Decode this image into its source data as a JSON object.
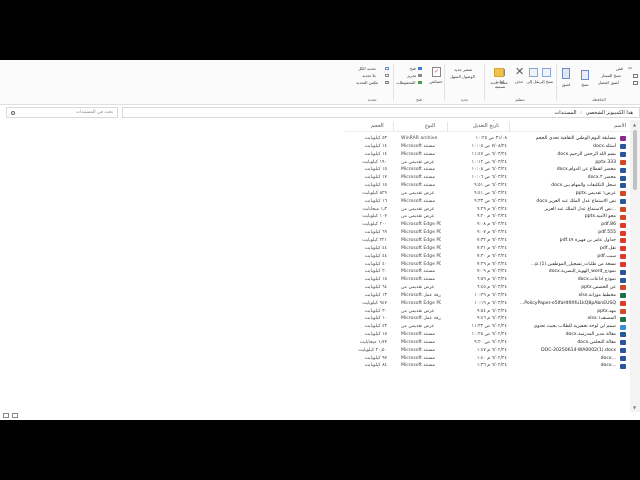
{
  "ribbon": {
    "clipboard": {
      "cut": "قص",
      "copy_path": "نسخ المسار",
      "paste_shortcut": "لصق اختصار",
      "copy": "نسخ",
      "paste": "لصق",
      "group_label": "الحافظة"
    },
    "organize": {
      "move_to": "نقل إلى",
      "copy_to": "نسخ إلى",
      "delete": "حذف",
      "rename": "إعادة تسمية",
      "group_label": "تنظيم"
    },
    "new": {
      "new_folder": "مجلد جديد",
      "new_item": "عنصر جديد",
      "easy_access": "الوصول السهل",
      "group_label": "جديد"
    },
    "open": {
      "properties": "خصائص",
      "open": "فتح",
      "edit": "تحرير",
      "history": "المحفوظات",
      "group_label": "فتح"
    },
    "select": {
      "select_all": "تحديد الكل",
      "select_none": "بلا تحديد",
      "invert_selection": "عكس التحديد",
      "group_label": "تحديد"
    }
  },
  "address": {
    "root": "هذا الكمبيوتر الشخصي",
    "current": "المستندات",
    "separator": "›"
  },
  "search": {
    "placeholder": "بحث في المستندات"
  },
  "columns": {
    "name": "الاسم",
    "date": "تاريخ التعديل",
    "type": "النوع",
    "size": "الحجم"
  },
  "files": [
    {
      "name": "مسابقة اليوم الوطني الثقافية تحدي الحجم",
      "date": "٣١/٠٨ ص ١٠:٢٥",
      "type": "WinRAR archive",
      "size": "٥٣ كيلوبايت",
      "icon": "rar"
    },
    {
      "name": "أسئلة.docx",
      "date": "٧/٠٨/٢٤ ص ١٠:٠٥",
      "type": "Microsoft مستند",
      "size": "١٤ كيلوبايت",
      "icon": "word"
    },
    {
      "name": "بسم الله الرحمن الرحيم.docx",
      "date": "٦/٠٣/٢٤ ص ١١:٤٧",
      "type": "Microsoft مستند",
      "size": "١٤ كيلوبايت",
      "icon": "word"
    },
    {
      "name": "333.pptx",
      "date": "٦/٠٣/٢٤ ص ١٠:١٢",
      "type": "عرض تقديمي من",
      "size": "١٩٠ كيلوبايت",
      "icon": "ppt"
    },
    {
      "name": "محضر انقطاع عن الدوام.docx",
      "date": "٦/٠٣/٢٤ ص ١٠:٠٨",
      "type": "Microsoft مستند",
      "size": "١٥ كيلوبايت",
      "icon": "word"
    },
    {
      "name": "محضر ٢.docx",
      "date": "٦/٠٣/٢٤ ص ١٠:٠٦",
      "type": "Microsoft مستند",
      "size": "١٧ كيلوبايت",
      "icon": "word"
    },
    {
      "name": "سجل التكليفات والمهام بين.docx",
      "date": "٦/٠٣/٢٤ ص ٩:٥١",
      "type": "Microsoft مستند",
      "size": "١٥ كيلوبايت",
      "icon": "word"
    },
    {
      "name": "عرض١ تقديمي.pptx",
      "date": "٦/٠٣/٢٤ ص ٩:٤١",
      "type": "عرض تقديمي من",
      "size": "٨٢٩ كيلوبايت",
      "icon": "ppt"
    },
    {
      "name": "نص الاستماع عدل الملك عبد العزيز.docx",
      "date": "٦/٠٣/٢٤ ص ٩:٣٣",
      "type": "Microsoft مستند",
      "size": "١٦ كيلوبايت",
      "icon": "word"
    },
    {
      "name": "...نص الاستماع عدل الملك عبد العزيز",
      "date": "٦/٠٣/٢٤ م ٩:٢٩",
      "type": "عرض تقديمي من",
      "size": "١٫٣ ميجابايت",
      "icon": "ppt"
    },
    {
      "name": "محو الأمية.pptx",
      "date": "٦/٠٣/٢٤ م ٩:٢٠",
      "type": "عرض تقديمي من",
      "size": "١٠٧ كيلوبايت",
      "icon": "ppt"
    },
    {
      "name": "86.pdf",
      "date": "٦/٠٣/٢٤ م ٩:٠٨",
      "type": "Microsoft Edge PD...",
      "size": "٢٠٠ كيلوبايت",
      "icon": "pdf"
    },
    {
      "name": "555.pdf",
      "date": "٦/٠٣/٢٤ م ٩:٠٧",
      "type": "Microsoft Edge PD...",
      "size": "٦٩ كيلوبايت",
      "icon": "pdf"
    },
    {
      "name": "جداول عامر بن فهيرة ٤٧.pdf",
      "date": "٦/٠٣/٢٤ م ٧:٣٢",
      "type": "Microsoft Edge PD...",
      "size": "٢٢١ كيلوبايت",
      "icon": "pdf"
    },
    {
      "name": "تقل.pdf",
      "date": "٦/٠٣/٢٤ م ٧:٣١",
      "type": "Microsoft Edge PD...",
      "size": "٤٤ كيلوبايت",
      "icon": "pdf"
    },
    {
      "name": "سبب.pdf",
      "date": "٦/٠٣/٢٤ م ٧:٣٠",
      "type": "Microsoft Edge PD...",
      "size": "٤٤ كيلوبايت",
      "icon": "pdf"
    },
    {
      "name": "نسخة من طلبات_تسجيل_الموظفين.(1).p...",
      "date": "٦/٠٣/٢٤ م ٧:٢٩",
      "type": "Microsoft Edge PD...",
      "size": "٤٠ كيلوبايت",
      "icon": "pdf"
    },
    {
      "name": "نموذج_word_الهوية_البصرية.docx",
      "date": "٦/٠٣/٢٤ م ٧:٠٩",
      "type": "Microsoft مستند",
      "size": "٢٠ كيلوبايت",
      "icon": "word"
    },
    {
      "name": "نموذج اذاعات.docx",
      "date": "٦/٠٣/٢٤ م ٦:٥٩",
      "type": "Microsoft مستند",
      "size": "١٥ كيلوبايت",
      "icon": "word"
    },
    {
      "name": "عن الحصص.pptx",
      "date": "٦/٠٣/٢٤ م ٦:٤٥",
      "type": "عرض تقديمي من",
      "size": "٦٤ كيلوبايت",
      "icon": "ppt"
    },
    {
      "name": "مخطط موزانة.xlsx",
      "date": "٦/٠٣/٢٤ م ١٠:٢٩",
      "type": "Microsoft ورقة عمل",
      "size": "١٣ كيلوبايت",
      "icon": "excel"
    },
    {
      "name": "PolicyPaper-e5lfaHt9Xfu1kQ8pAbnEUSQ...",
      "date": "٦/٠٣/٢٤ م ١٠:١٩",
      "type": "Microsoft Edge PD...",
      "size": "٩٤٧ كيلوبايت",
      "icon": "pdf"
    },
    {
      "name": "مهد.pptx",
      "date": "٦/٠٣/٢٤ م ٩:٥٤",
      "type": "عرض تقديمي من",
      "size": "٣٠ كيلوبايت",
      "icon": "ppt"
    },
    {
      "name": "المصنف١.xlsx",
      "date": "٦/٠٣/٢٤ م ٩:٤٦",
      "type": "Microsoft ورقة عمل",
      "size": "١٠ كيلوبايت",
      "icon": "excel"
    },
    {
      "name": "صمم لي لوحة تحفيزية للطلاب بحيث تحتوي",
      "date": "٦/٠٢/٢٤ ص ١١:٣٣",
      "type": "عرض تقديمي من",
      "size": "٤٣ كيلوبايت",
      "icon": "image"
    },
    {
      "name": "مقالة مدير المدرسة.docx",
      "date": "٦/٠٢/٢٤ ص ١٠:٢٥",
      "type": "Microsoft مستند",
      "size": "١٥ كيلوبايت",
      "icon": "word"
    },
    {
      "name": "مقالة التحلمن.docx",
      "date": "٦/٠٢/٢٤ ص ٩:٢٠",
      "type": "Microsoft مستند",
      "size": "١٫٧٧ ميجابايت",
      "icon": "word"
    },
    {
      "name": "DOC-20250614-WA0002(1).docx",
      "date": "٦/٠٢/٢٤ م ١:٤٧",
      "type": "Microsoft مستند",
      "size": "٢٠٫٥٠ كيلوبايت",
      "icon": "word"
    },
    {
      "name": "...docx",
      "date": "٦/٠٢/٢٤ م ١:٤٠",
      "type": "Microsoft مستند",
      "size": "٩٧ كيلوبايت",
      "icon": "word"
    },
    {
      "name": "...docx",
      "date": "٦/٠٢/٢٤ م ١:٣٦",
      "type": "Microsoft مستند",
      "size": "٨٤ كيلوبايت",
      "icon": "word"
    }
  ],
  "colors": {
    "word": "#2b579a",
    "ppt": "#d24726",
    "pdf": "#e03a2a",
    "excel": "#1e7145",
    "rar": "#8b2a8e"
  }
}
